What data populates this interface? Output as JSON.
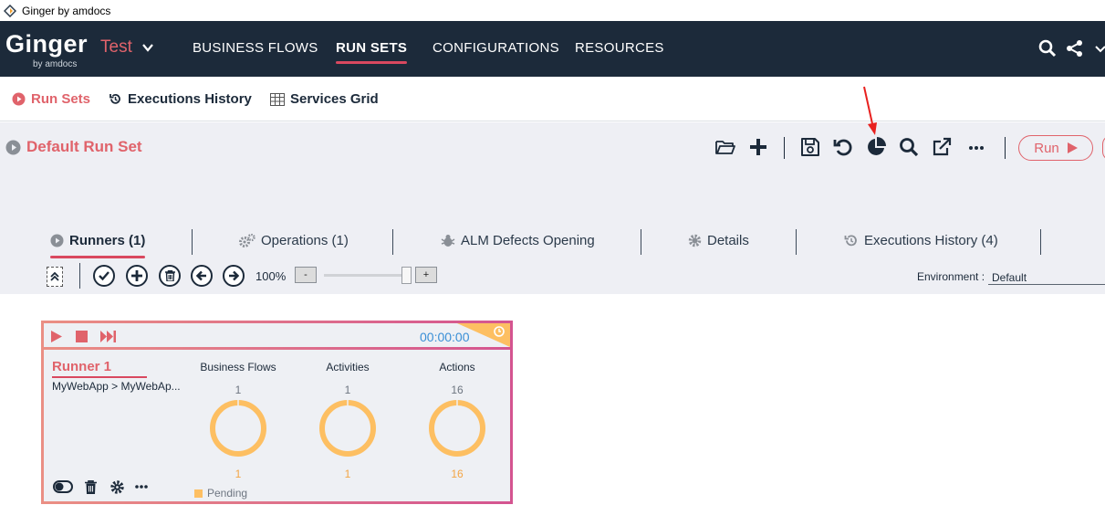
{
  "window": {
    "title": "Ginger by amdocs"
  },
  "brand": {
    "name": "Ginger",
    "byline": "by amdocs",
    "solution": "Test"
  },
  "topnav": {
    "items": [
      "BUSINESS FLOWS",
      "RUN SETS",
      "CONFIGURATIONS",
      "RESOURCES"
    ],
    "active_index": 1
  },
  "subnav": {
    "run_sets": "Run Sets",
    "executions_history": "Executions History",
    "services_grid": "Services Grid"
  },
  "runset": {
    "title": "Default Run Set",
    "toolbar_icons": [
      "open-folder-icon",
      "add-icon",
      "save-icon",
      "undo-icon",
      "analyze-pie-icon",
      "search-icon",
      "export-icon",
      "more-icon"
    ],
    "run_label": "Run"
  },
  "tabs": {
    "runners": "Runners (1)",
    "operations": "Operations (1)",
    "alm_defects": "ALM Defects Opening",
    "details": "Details",
    "exec_history": "Executions History (4)"
  },
  "runner_toolbar": {
    "zoom": "100%",
    "zoom_minus": "-",
    "zoom_plus": "+",
    "zoom_level": 0.9,
    "environment_label": "Environment :",
    "environment_value": "Default"
  },
  "runner": {
    "name": "Runner 1",
    "path": "MyWebApp > MyWebAp...",
    "timer": "00:00:00",
    "columns": [
      {
        "header": "Business Flows",
        "total": "1",
        "pending": "1"
      },
      {
        "header": "Activities",
        "total": "1",
        "pending": "1"
      },
      {
        "header": "Actions",
        "total": "16",
        "pending": "16"
      }
    ],
    "legend_pending": "Pending"
  },
  "colors": {
    "accent": "#e0636b",
    "nav_bg": "#1c2a3a",
    "pending": "#fdbf62",
    "timer": "#3a8fd6"
  }
}
